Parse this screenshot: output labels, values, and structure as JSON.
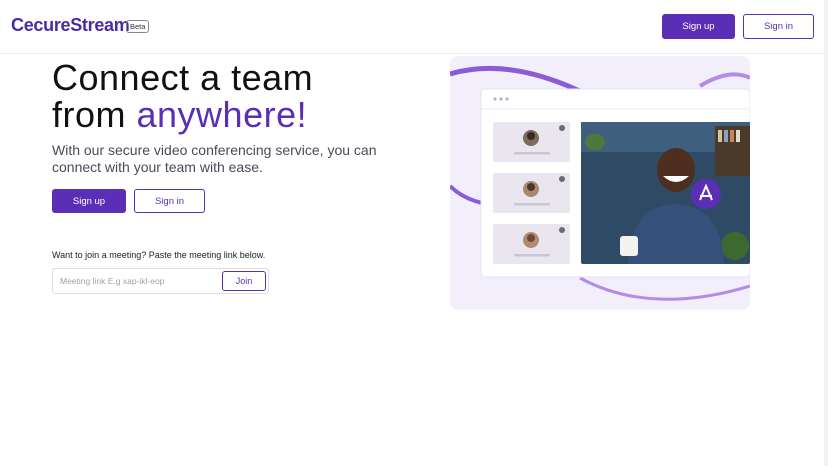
{
  "header": {
    "brand": "CecureStream",
    "badge": "Beta",
    "signup_label": "Sign up",
    "signin_label": "Sign in"
  },
  "hero": {
    "title_line1": "Connect a team",
    "title_line2_prefix": "from ",
    "title_line2_accent": "anywhere!",
    "subtitle": "With our secure video conferencing service, you can connect with your team with ease.",
    "signup_label": "Sign up",
    "signin_label": "Sign in"
  },
  "join": {
    "label": "Want to join a meeting? Paste the meeting link below.",
    "placeholder": "Meeting link E.g xap-ikl-eop",
    "value": "",
    "button_label": "Join"
  },
  "illustration": {
    "participants_count": 3,
    "icons": [
      "mic-off-icon",
      "hand-wave-icon"
    ]
  },
  "colors": {
    "accent": "#5b2fb5",
    "brand": "#4b2aa6",
    "illustration_bg": "#f3eefc"
  }
}
